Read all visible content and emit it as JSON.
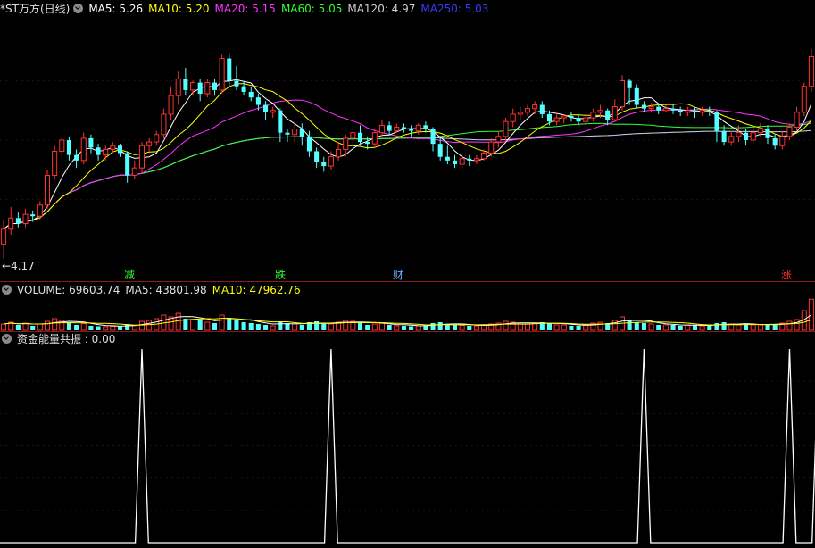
{
  "header": {
    "stock": "*ST万方(日线)",
    "ma5": "MA5: 5.26",
    "ma10": "MA10: 5.20",
    "ma20": "MA20: 5.15",
    "ma60": "MA60: 5.05",
    "ma120": "MA120: 4.97",
    "ma250": "MA250: 5.03"
  },
  "price_panel": {
    "low_label": "4.17",
    "tags": {
      "t1": "减",
      "t2": "跌",
      "t3": "财",
      "t4": "涨"
    }
  },
  "volume_panel": {
    "volume": "VOLUME: 69603.74",
    "ma5": "MA5: 43801.98",
    "ma10": "MA10: 47962.76"
  },
  "indicator_panel": {
    "label": "资金能量共振 : 0.00"
  },
  "colors": {
    "up": "#ff3232",
    "down": "#54ffff",
    "ma5": "#ffffff",
    "ma10": "#ffff00",
    "ma20": "#ff33ff",
    "ma60": "#33ff33",
    "ma120": "#cccccc",
    "ma250": "#3333ff"
  },
  "chart_data": {
    "type": "candlestick",
    "ylim": [
      4.17,
      5.45
    ],
    "candles": [
      [
        4.25,
        4.33,
        4.17,
        4.38
      ],
      [
        4.33,
        4.39,
        4.3,
        4.45
      ],
      [
        4.39,
        4.36,
        4.34,
        4.42
      ],
      [
        4.36,
        4.41,
        4.34,
        4.44
      ],
      [
        4.41,
        4.4,
        4.37,
        4.43
      ],
      [
        4.4,
        4.46,
        4.38,
        4.48
      ],
      [
        4.46,
        4.62,
        4.44,
        4.65
      ],
      [
        4.62,
        4.75,
        4.6,
        4.78
      ],
      [
        4.75,
        4.81,
        4.72,
        4.83
      ],
      [
        4.81,
        4.73,
        4.7,
        4.83
      ],
      [
        4.73,
        4.7,
        4.66,
        4.76
      ],
      [
        4.7,
        4.82,
        4.68,
        4.85
      ],
      [
        4.82,
        4.77,
        4.74,
        4.84
      ],
      [
        4.77,
        4.73,
        4.7,
        4.79
      ],
      [
        4.73,
        4.76,
        4.7,
        4.78
      ],
      [
        4.76,
        4.78,
        4.74,
        4.8
      ],
      [
        4.78,
        4.74,
        4.72,
        4.79
      ],
      [
        4.74,
        4.62,
        4.58,
        4.75
      ],
      [
        4.62,
        4.66,
        4.6,
        4.7
      ],
      [
        4.66,
        4.78,
        4.63,
        4.8
      ],
      [
        4.78,
        4.8,
        4.75,
        4.82
      ],
      [
        4.8,
        4.84,
        4.78,
        4.86
      ],
      [
        4.84,
        4.95,
        4.82,
        4.98
      ],
      [
        4.95,
        5.05,
        4.92,
        5.1
      ],
      [
        5.05,
        5.14,
        5.0,
        5.18
      ],
      [
        5.14,
        5.08,
        5.05,
        5.2
      ],
      [
        5.08,
        5.12,
        5.05,
        5.13
      ],
      [
        5.12,
        5.06,
        5.02,
        5.14
      ],
      [
        5.06,
        5.12,
        5.04,
        5.14
      ],
      [
        5.12,
        5.08,
        5.05,
        5.14
      ],
      [
        5.08,
        5.25,
        5.06,
        5.27
      ],
      [
        5.25,
        5.13,
        5.1,
        5.28
      ],
      [
        5.13,
        5.1,
        5.08,
        5.21
      ],
      [
        5.1,
        5.07,
        5.05,
        5.13
      ],
      [
        5.07,
        5.04,
        5.02,
        5.1
      ],
      [
        5.04,
        5.0,
        4.97,
        5.06
      ],
      [
        5.0,
        4.96,
        4.92,
        5.02
      ],
      [
        4.96,
        4.97,
        4.93,
        4.99
      ],
      [
        4.97,
        4.85,
        4.8,
        4.98
      ],
      [
        4.85,
        4.84,
        4.8,
        4.87
      ],
      [
        4.84,
        4.87,
        4.8,
        4.9
      ],
      [
        4.87,
        4.83,
        4.78,
        4.9
      ],
      [
        4.83,
        4.75,
        4.72,
        4.86
      ],
      [
        4.75,
        4.69,
        4.66,
        4.77
      ],
      [
        4.69,
        4.67,
        4.64,
        4.72
      ],
      [
        4.67,
        4.72,
        4.65,
        4.75
      ],
      [
        4.72,
        4.76,
        4.7,
        4.8
      ],
      [
        4.76,
        4.82,
        4.72,
        4.84
      ],
      [
        4.82,
        4.85,
        4.78,
        4.88
      ],
      [
        4.85,
        4.8,
        4.78,
        4.89
      ],
      [
        4.8,
        4.79,
        4.76,
        4.83
      ],
      [
        4.79,
        4.85,
        4.77,
        4.87
      ],
      [
        4.85,
        4.89,
        4.83,
        4.92
      ],
      [
        4.89,
        4.86,
        4.84,
        4.91
      ],
      [
        4.86,
        4.88,
        4.85,
        4.9
      ],
      [
        4.88,
        4.87,
        4.85,
        4.9
      ],
      [
        4.87,
        4.86,
        4.83,
        4.89
      ],
      [
        4.86,
        4.89,
        4.84,
        4.9
      ],
      [
        4.89,
        4.87,
        4.85,
        4.91
      ],
      [
        4.87,
        4.79,
        4.75,
        4.88
      ],
      [
        4.79,
        4.72,
        4.7,
        4.82
      ],
      [
        4.72,
        4.7,
        4.68,
        4.78
      ],
      [
        4.7,
        4.68,
        4.66,
        4.73
      ],
      [
        4.68,
        4.71,
        4.65,
        4.74
      ],
      [
        4.71,
        4.7,
        4.67,
        4.73
      ],
      [
        4.7,
        4.71,
        4.68,
        4.73
      ],
      [
        4.71,
        4.74,
        4.7,
        4.76
      ],
      [
        4.74,
        4.8,
        4.72,
        4.82
      ],
      [
        4.8,
        4.83,
        4.77,
        4.86
      ],
      [
        4.83,
        4.91,
        4.8,
        4.93
      ],
      [
        4.91,
        4.95,
        4.88,
        4.98
      ],
      [
        4.95,
        4.96,
        4.92,
        4.99
      ],
      [
        4.96,
        4.98,
        4.94,
        5.0
      ],
      [
        4.98,
        5.0,
        4.95,
        5.02
      ],
      [
        5.0,
        4.95,
        4.93,
        5.02
      ],
      [
        4.95,
        4.91,
        4.89,
        4.97
      ],
      [
        4.91,
        4.93,
        4.89,
        4.96
      ],
      [
        4.93,
        4.94,
        4.9,
        4.95
      ],
      [
        4.94,
        4.93,
        4.91,
        4.96
      ],
      [
        4.93,
        4.91,
        4.89,
        4.95
      ],
      [
        4.91,
        4.93,
        4.89,
        4.95
      ],
      [
        4.93,
        4.96,
        4.91,
        4.98
      ],
      [
        4.96,
        4.97,
        4.93,
        5.0
      ],
      [
        4.97,
        4.92,
        4.89,
        4.98
      ],
      [
        4.92,
        4.99,
        4.91,
        5.03
      ],
      [
        4.99,
        5.13,
        4.97,
        5.16
      ],
      [
        5.13,
        5.09,
        5.0,
        5.14
      ],
      [
        5.09,
        5.0,
        4.98,
        5.11
      ],
      [
        5.0,
        4.98,
        4.96,
        5.02
      ],
      [
        4.98,
        4.99,
        4.96,
        5.01
      ],
      [
        4.99,
        4.97,
        4.95,
        5.01
      ],
      [
        4.97,
        4.98,
        4.96,
        5.0
      ],
      [
        4.98,
        4.97,
        4.95,
        5.0
      ],
      [
        4.97,
        4.96,
        4.94,
        4.99
      ],
      [
        4.96,
        4.97,
        4.94,
        4.99
      ],
      [
        4.97,
        4.96,
        4.93,
        4.99
      ],
      [
        4.96,
        4.97,
        4.94,
        4.99
      ],
      [
        4.97,
        4.96,
        4.94,
        4.99
      ],
      [
        4.96,
        4.86,
        4.8,
        4.97
      ],
      [
        4.86,
        4.8,
        4.78,
        4.89
      ],
      [
        4.8,
        4.83,
        4.78,
        4.86
      ],
      [
        4.83,
        4.85,
        4.8,
        4.89
      ],
      [
        4.85,
        4.81,
        4.78,
        4.87
      ],
      [
        4.81,
        4.85,
        4.79,
        4.89
      ],
      [
        4.85,
        4.87,
        4.83,
        4.9
      ],
      [
        4.87,
        4.82,
        4.79,
        4.89
      ],
      [
        4.82,
        4.78,
        4.76,
        4.84
      ],
      [
        4.78,
        4.83,
        4.76,
        4.86
      ],
      [
        4.83,
        4.88,
        4.81,
        4.9
      ],
      [
        4.88,
        4.96,
        4.86,
        4.99
      ],
      [
        4.96,
        5.1,
        4.94,
        5.12
      ],
      [
        5.1,
        5.26,
        5.07,
        5.3
      ]
    ],
    "volume_ylim": [
      0,
      70000
    ],
    "volume": [
      14000,
      18000,
      12000,
      16000,
      10000,
      14000,
      20000,
      26000,
      22000,
      18000,
      12000,
      15000,
      10000,
      9000,
      8000,
      9000,
      10000,
      14000,
      11000,
      20000,
      22000,
      26000,
      34000,
      30000,
      38000,
      26000,
      24000,
      22000,
      18000,
      16000,
      34000,
      28000,
      22000,
      18000,
      16000,
      14000,
      12000,
      10000,
      20000,
      16000,
      14000,
      12000,
      18000,
      20000,
      16000,
      14000,
      18000,
      22000,
      20000,
      18000,
      12000,
      14000,
      16000,
      12000,
      10000,
      10000,
      9000,
      10000,
      11000,
      16000,
      18000,
      14000,
      12000,
      11000,
      10000,
      10000,
      12000,
      14000,
      16000,
      20000,
      18000,
      14000,
      14000,
      16000,
      18000,
      16000,
      12000,
      12000,
      10000,
      10000,
      12000,
      16000,
      18000,
      16000,
      22000,
      30000,
      24000,
      18000,
      16000,
      14000,
      12000,
      12000,
      12000,
      10000,
      12000,
      12000,
      10000,
      10000,
      16000,
      18000,
      14000,
      12000,
      14000,
      12000,
      12000,
      12000,
      14000,
      16000,
      20000,
      24000,
      44000,
      69603
    ],
    "signal_spikes": [
      19,
      45,
      88,
      108,
      112
    ],
    "signal_ylim": [
      0,
      1
    ]
  }
}
